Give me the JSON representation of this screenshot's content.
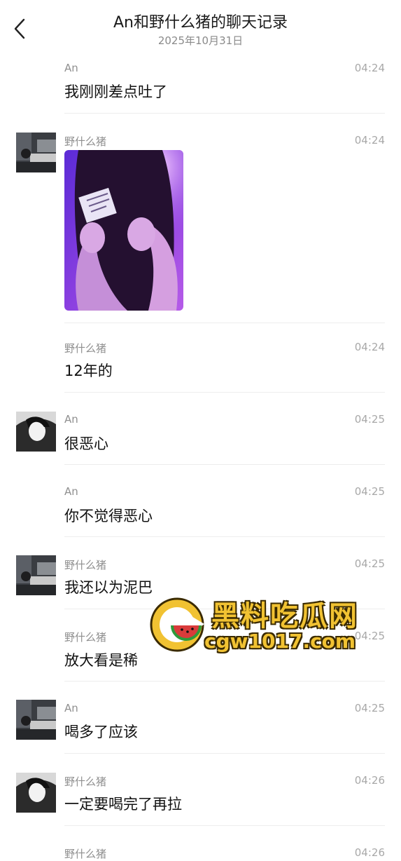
{
  "header": {
    "title": "An和野什么猪的聊天记录",
    "date": "2025年10月31日"
  },
  "messages": [
    {
      "sender": "An",
      "time": "04:24",
      "text": "我刚刚差点吐了",
      "avatar": false
    },
    {
      "sender": "野什么猪",
      "time": "04:24",
      "text": "",
      "avatar": "dark-room",
      "image": "photo-selfie-purple-light"
    },
    {
      "sender": "野什么猪",
      "time": "04:24",
      "text": "12年的",
      "avatar": false
    },
    {
      "sender": "An",
      "time": "04:25",
      "text": "很恶心",
      "avatar": "bw-portrait"
    },
    {
      "sender": "An",
      "time": "04:25",
      "text": "你不觉得恶心",
      "avatar": false
    },
    {
      "sender": "野什么猪",
      "time": "04:25",
      "text": "我还以为泥巴",
      "avatar": "dark-room"
    },
    {
      "sender": "野什么猪",
      "time": "04:25",
      "text": "放大看是稀",
      "avatar": false
    },
    {
      "sender": "An",
      "time": "04:25",
      "text": "喝多了应该",
      "avatar": "dark-room"
    },
    {
      "sender": "野什么猪",
      "time": "04:26",
      "text": "一定要喝完了再拉",
      "avatar": "bw-portrait"
    },
    {
      "sender": "野什么猪",
      "time": "04:26",
      "text": "",
      "avatar": false
    }
  ],
  "watermark": {
    "title": "黑料吃瓜网",
    "url": "cgw1017.com",
    "icon": "watermelon-logo-icon",
    "color": "#f1c232"
  },
  "colors": {
    "background": "#ffffff",
    "meta_text": "#8f8f8f",
    "time_text": "#a8a8a8",
    "divider": "#ededed"
  }
}
